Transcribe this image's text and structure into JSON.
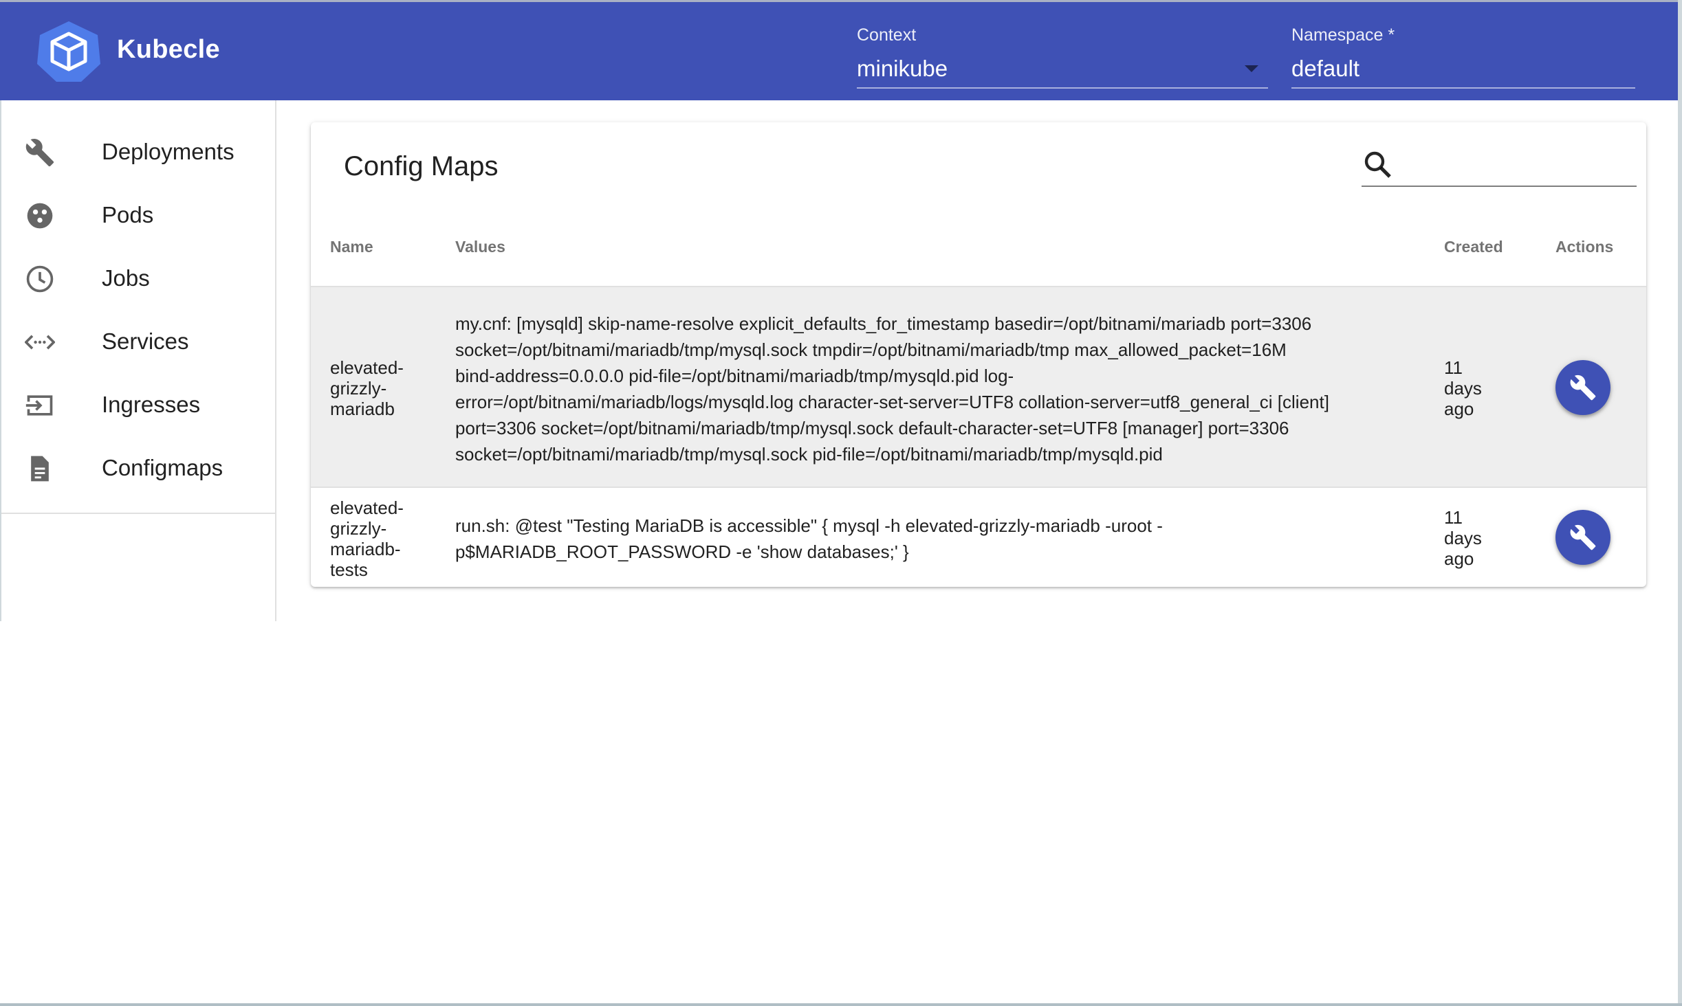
{
  "app": {
    "title": "Kubecle"
  },
  "header": {
    "context_label": "Context",
    "context_value": "minikube",
    "namespace_label": "Namespace *",
    "namespace_value": "default"
  },
  "sidebar": {
    "items": [
      {
        "label": "Deployments",
        "icon": "wrench-icon"
      },
      {
        "label": "Pods",
        "icon": "pods-icon"
      },
      {
        "label": "Jobs",
        "icon": "clock-icon"
      },
      {
        "label": "Services",
        "icon": "code-arrows-icon"
      },
      {
        "label": "Ingresses",
        "icon": "input-icon"
      },
      {
        "label": "Configmaps",
        "icon": "document-icon"
      }
    ]
  },
  "main": {
    "title": "Config Maps",
    "search": {
      "placeholder": "",
      "value": ""
    },
    "columns": [
      "Name",
      "Values",
      "Created",
      "Actions"
    ],
    "rows": [
      {
        "name_lines": [
          "elevated-",
          "grizzly-",
          "mariadb"
        ],
        "values_lines": [
          "my.cnf: [mysqld] skip-name-resolve explicit_defaults_for_timestamp basedir=/opt/bitnami/mariadb port=3306",
          "socket=/opt/bitnami/mariadb/tmp/mysql.sock tmpdir=/opt/bitnami/mariadb/tmp max_allowed_packet=16M",
          "bind-address=0.0.0.0 pid-file=/opt/bitnami/mariadb/tmp/mysqld.pid log-",
          "error=/opt/bitnami/mariadb/logs/mysqld.log character-set-server=UTF8 collation-server=utf8_general_ci [client]",
          "port=3306 socket=/opt/bitnami/mariadb/tmp/mysql.sock default-character-set=UTF8 [manager] port=3306",
          "socket=/opt/bitnami/mariadb/tmp/mysql.sock pid-file=/opt/bitnami/mariadb/tmp/mysqld.pid"
        ],
        "created_lines": [
          "11",
          "days",
          "ago"
        ],
        "action_icon": "wrench-icon"
      },
      {
        "name_lines": [
          "elevated-",
          "grizzly-",
          "mariadb-",
          "tests"
        ],
        "values_lines": [
          "run.sh: @test \"Testing MariaDB is accessible\" { mysql -h elevated-grizzly-mariadb -uroot -",
          "p$MARIADB_ROOT_PASSWORD -e 'show databases;' }"
        ],
        "created_lines": [
          "11",
          "days",
          "ago"
        ],
        "action_icon": "wrench-icon"
      }
    ]
  },
  "colors": {
    "primary": "#3f51b5",
    "row_highlight": "#eeeeee"
  }
}
